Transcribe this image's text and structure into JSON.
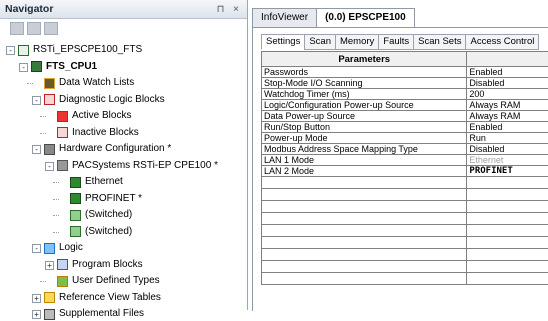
{
  "navigator": {
    "title": "Navigator",
    "pin_glyph": "⊓",
    "close_glyph": "×"
  },
  "tree": [
    {
      "label": "RSTi_EPSCPE100_FTS",
      "icon": "project-icon",
      "bold": false
    },
    {
      "label": "FTS_CPU1",
      "icon": "target-icon",
      "bold": true
    },
    {
      "label": "Data Watch Lists",
      "icon": "watch-list-icon",
      "bold": false
    },
    {
      "label": "Diagnostic Logic Blocks",
      "icon": "diagnostic-icon",
      "bold": false
    },
    {
      "label": "Active Blocks",
      "icon": "active-block-icon",
      "bold": false
    },
    {
      "label": "Inactive Blocks",
      "icon": "inactive-block-icon",
      "bold": false
    },
    {
      "label": "Hardware Configuration *",
      "icon": "hardware-icon",
      "bold": false
    },
    {
      "label": "PACSystems RSTi-EP CPE100 *",
      "icon": "cpu-icon",
      "bold": false
    },
    {
      "label": "Ethernet",
      "icon": "ethernet-icon",
      "bold": false
    },
    {
      "label": "PROFINET *",
      "icon": "profinet-icon",
      "bold": false
    },
    {
      "label": "(Switched)",
      "icon": "port-icon",
      "bold": false
    },
    {
      "label": "(Switched)",
      "icon": "port-icon",
      "bold": false
    },
    {
      "label": "Logic",
      "icon": "logic-icon",
      "bold": false
    },
    {
      "label": "Program Blocks",
      "icon": "program-blocks-icon",
      "bold": false
    },
    {
      "label": "User Defined Types",
      "icon": "udt-icon",
      "bold": false
    },
    {
      "label": "Reference View Tables",
      "icon": "reference-table-icon",
      "bold": false
    },
    {
      "label": "Supplemental Files",
      "icon": "supplemental-files-icon",
      "bold": false
    }
  ],
  "tabs": [
    "InfoViewer",
    "(0.0) EPSCPE100"
  ],
  "subtabs": [
    "Settings",
    "Scan",
    "Memory",
    "Faults",
    "Scan Sets",
    "Access Control"
  ],
  "table": {
    "header": "Parameters",
    "rows": [
      {
        "param": "Passwords",
        "value": "Enabled"
      },
      {
        "param": "Stop-Mode I/O Scanning",
        "value": "Disabled"
      },
      {
        "param": "Watchdog Timer (ms)",
        "value": "200"
      },
      {
        "param": "Logic/Configuration Power-up Source",
        "value": "Always RAM"
      },
      {
        "param": "Data Power-up Source",
        "value": "Always RAM"
      },
      {
        "param": "Run/Stop Button",
        "value": "Enabled"
      },
      {
        "param": "Power-up Mode",
        "value": "Run"
      },
      {
        "param": "Modbus Address Space Mapping Type",
        "value": "Disabled"
      },
      {
        "param": "LAN 1 Mode",
        "value": "Ethernet"
      },
      {
        "param": "LAN 2 Mode",
        "value": "PROFINET"
      }
    ]
  },
  "colors": {
    "dim_value": "#a0a0a0",
    "border": "#808080"
  }
}
